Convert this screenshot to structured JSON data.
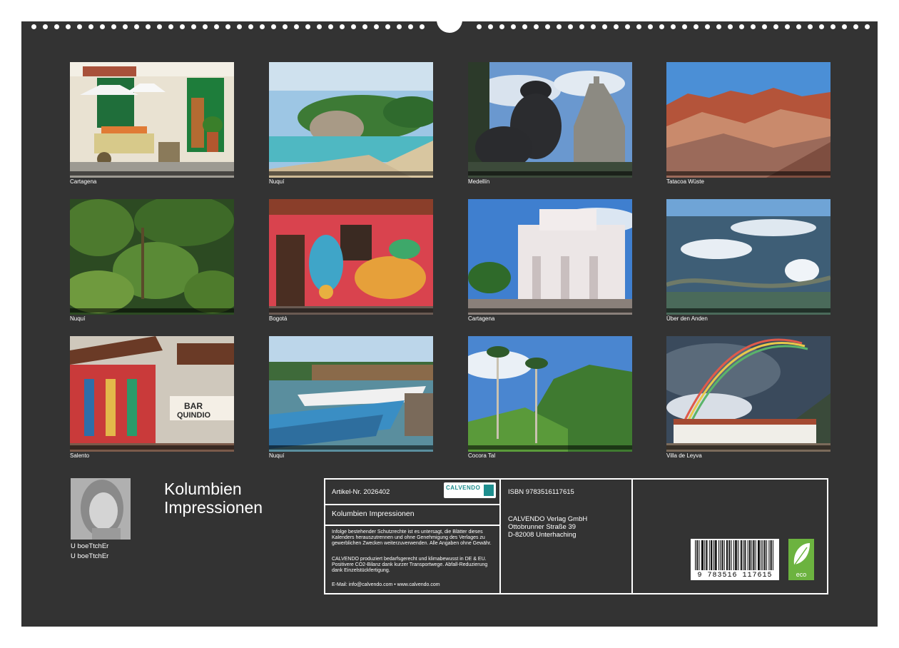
{
  "captions": [
    "Cartagena",
    "Nuquí",
    "Medellín",
    "Tatacoa Wüste",
    "Nuquí",
    "Bogotá",
    "Cartagena",
    "Über den Anden",
    "Salento",
    "Nuquí",
    "Cocora Tal",
    "Villa de Leyva"
  ],
  "title": {
    "line1": "Kolumbien",
    "line2": "Impressionen"
  },
  "author": {
    "line1": "U boeTtchEr",
    "line2": "U boeTtchEr"
  },
  "info": {
    "article_no": "Artikel-Nr. 2026402",
    "logo_text": "CALVENDO",
    "calendar_title": "Kolumbien Impressionen",
    "legal1": "Infolge bestehender Schutzrechte ist es untersagt, die Blätter dieses Kalenders herauszutrennen und ohne Genehmigung des Verlages zu gewerblichen Zwecken weiterzuverwenden. Alle Angaben ohne Gewähr.",
    "legal2": "CALVENDO produziert bedarfsgerecht und klimabewusst in DE & EU. Positivere CO2-Bilanz dank kurzer Transportwege. Abfall-Reduzierung dank Einzelstückfertigung.",
    "contact": "E-Mail: info@calvendo.com • www.calvendo.com",
    "isbn": "ISBN 9783516117615",
    "publisher1": "CALVENDO Verlag GmbH",
    "publisher2": "Ottobrunner Straße 39",
    "publisher3": "D-82008 Unterhaching"
  },
  "barcode_digits": "9 783516 117615",
  "eco_label": "eco",
  "colors": {
    "page_background": "#333333",
    "calvendo_teal": "#1e8e8e",
    "eco_green": "#6cb33f"
  }
}
